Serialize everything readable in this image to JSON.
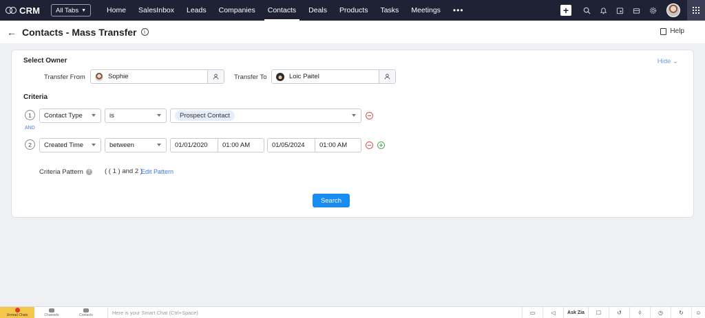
{
  "app": {
    "name": "CRM",
    "all_tabs_label": "All Tabs",
    "nav": [
      "Home",
      "SalesInbox",
      "Leads",
      "Companies",
      "Contacts",
      "Deals",
      "Products",
      "Tasks",
      "Meetings"
    ],
    "active_tab": "Contacts",
    "more_label": "•••"
  },
  "page": {
    "title": "Contacts - Mass Transfer",
    "help_label": "Help"
  },
  "owner": {
    "section_title": "Select Owner",
    "hide_label": "Hide",
    "transfer_from_label": "Transfer From",
    "transfer_from_value": "Sophie",
    "transfer_to_label": "Transfer To",
    "transfer_to_value": "Loic Paitel"
  },
  "criteria": {
    "section_title": "Criteria",
    "and_label": "AND",
    "rows": [
      {
        "num": "1",
        "field": "Contact Type",
        "operator": "is",
        "value": "Prospect Contact"
      },
      {
        "num": "2",
        "field": "Created Time",
        "operator": "between",
        "from_date": "01/01/2020",
        "from_time": "01:00 AM",
        "to_date": "01/05/2024",
        "to_time": "01:00 AM"
      }
    ],
    "pattern_label": "Criteria Pattern",
    "pattern_value": "( ( 1 ) and 2 )",
    "edit_pattern_label": "Edit Pattern",
    "search_label": "Search"
  },
  "footer": {
    "items": [
      "Unread Chats",
      "Channels",
      "Contacts"
    ],
    "smart_chat_placeholder": "Here is your Smart Chat (Ctrl+Space)",
    "ask_zia_label": "Ask Zia"
  },
  "colors": {
    "topbar": "#1f2235",
    "accent": "#1a8cf0",
    "remove": "#d9534f",
    "add": "#4caf50"
  }
}
